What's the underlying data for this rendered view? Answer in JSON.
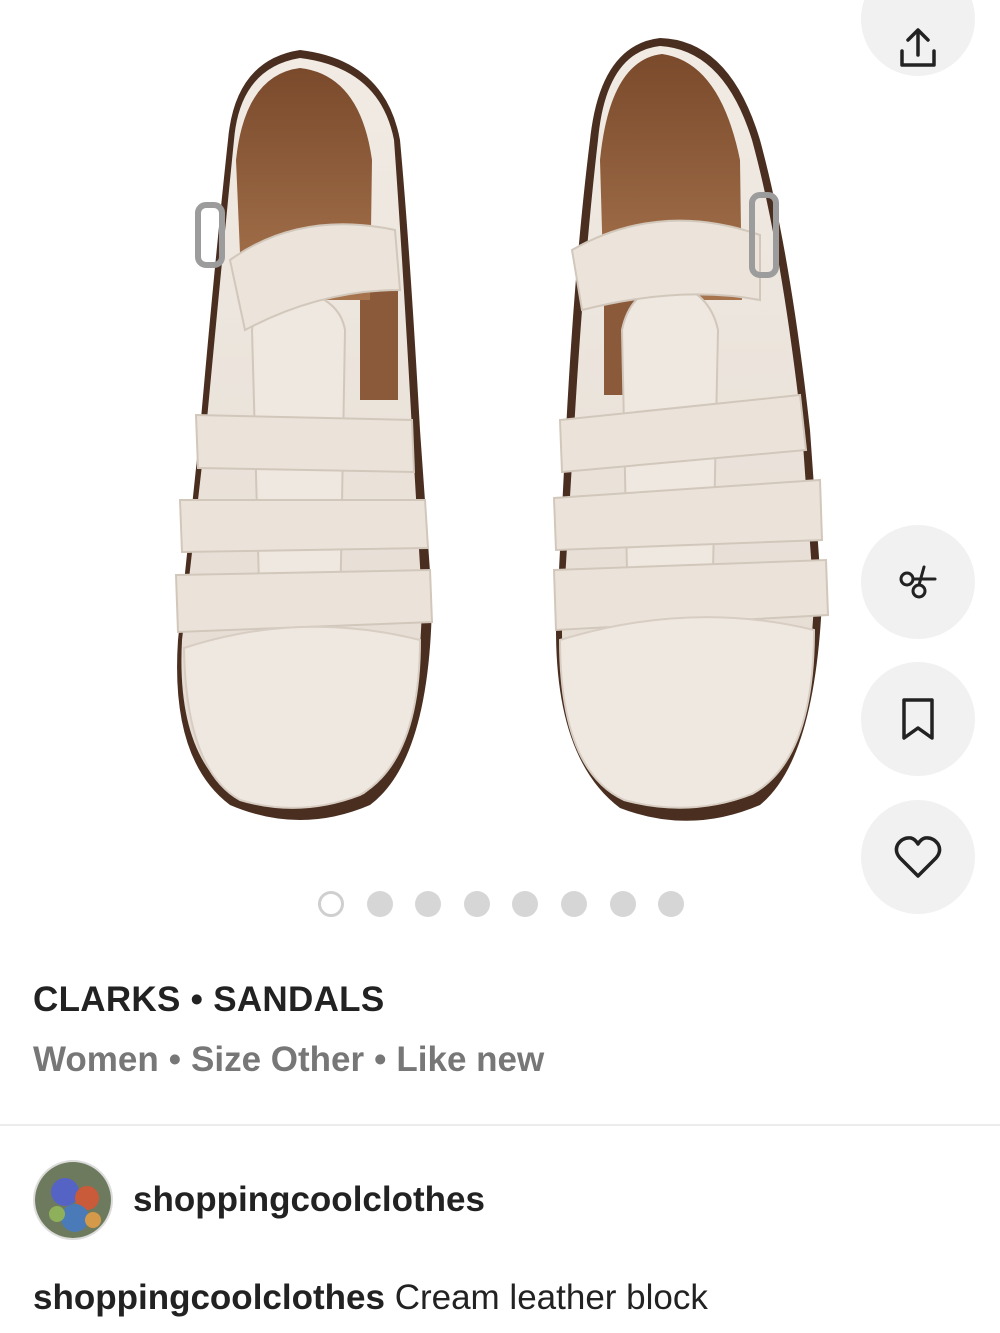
{
  "product_image": {
    "alt": "Cream leather Clarks sandals, top view",
    "brand_imprint": "Clarks"
  },
  "actions": {
    "share_icon": "share-icon",
    "offer_icon": "offer-tag-icon",
    "save_icon": "bookmark-icon",
    "like_icon": "heart-icon"
  },
  "carousel": {
    "total": 8,
    "active_index": 0
  },
  "listing": {
    "brand": "CLARKS",
    "category": "SANDALS",
    "separator": "•",
    "department": "Women",
    "size": "Size Other",
    "condition": "Like new"
  },
  "seller": {
    "username": "shoppingcoolclothes"
  },
  "description": {
    "username": "shoppingcoolclothes",
    "text": "Cream leather block"
  },
  "colors": {
    "fab_bg": "#f1f1f1",
    "muted_text": "#777777",
    "leather": "#ece4dc",
    "insole": "#8a5a38",
    "sole": "#4a2e20"
  }
}
